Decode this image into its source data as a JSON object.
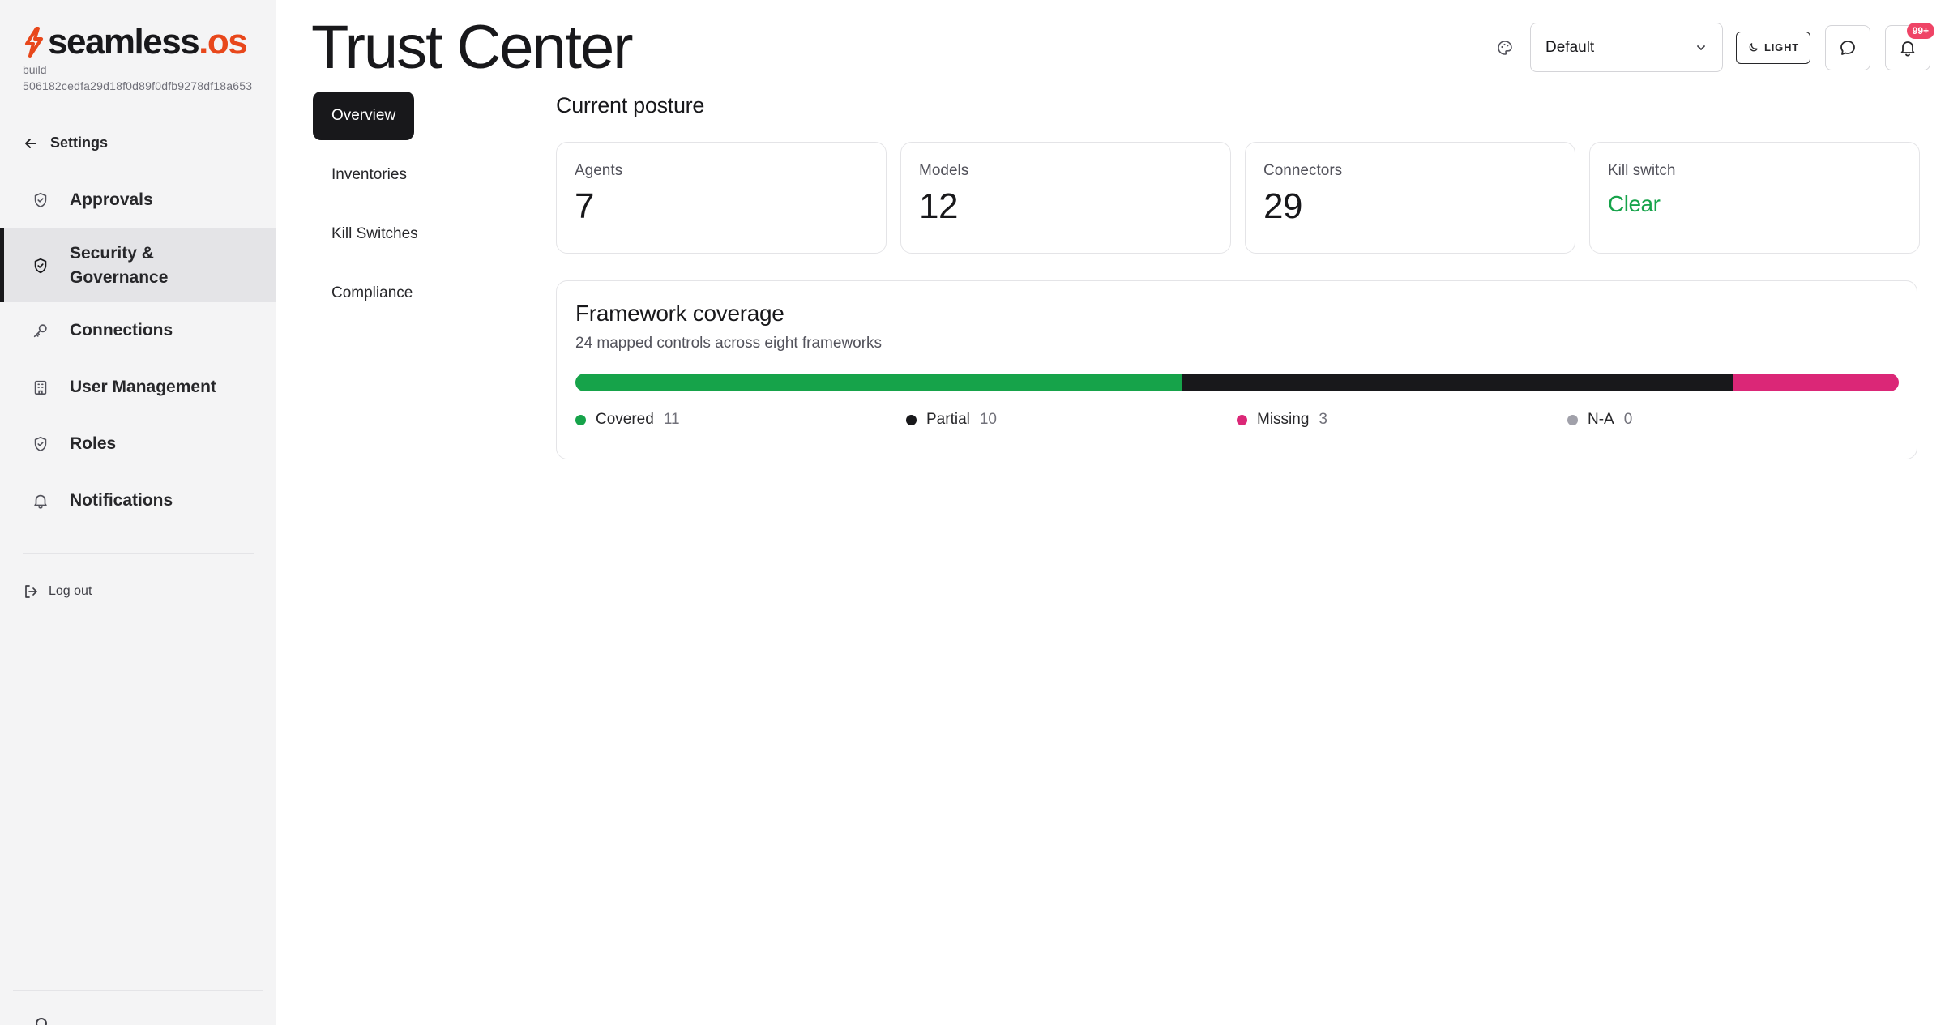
{
  "brand": {
    "logo_main": "seamless",
    "logo_suffix": ".os",
    "build_label": "build",
    "build_hash": "506182cedfa29d18f0d89f0dfb9278df18a653"
  },
  "sidebar": {
    "back_label": "Settings",
    "items": [
      {
        "label": "Approvals",
        "icon": "shield-check-icon",
        "active": false
      },
      {
        "label": "Security & Governance",
        "icon": "shield-check-icon",
        "active": true
      },
      {
        "label": "Connections",
        "icon": "key-icon",
        "active": false
      },
      {
        "label": "User Management",
        "icon": "building-icon",
        "active": false
      },
      {
        "label": "Roles",
        "icon": "shield-check-icon",
        "active": false
      },
      {
        "label": "Notifications",
        "icon": "bell-icon",
        "active": false
      }
    ],
    "logout_label": "Log out"
  },
  "header": {
    "title": "Trust Center",
    "theme_select_value": "Default",
    "mode_button_label": "LIGHT",
    "notification_badge": "99+"
  },
  "subtabs": [
    {
      "label": "Overview",
      "active": true
    },
    {
      "label": "Inventories",
      "active": false
    },
    {
      "label": "Kill Switches",
      "active": false
    },
    {
      "label": "Compliance",
      "active": false
    }
  ],
  "posture": {
    "title": "Current posture",
    "stats": [
      {
        "label": "Agents",
        "value": "7"
      },
      {
        "label": "Models",
        "value": "12"
      },
      {
        "label": "Connectors",
        "value": "29"
      },
      {
        "label": "Kill switch",
        "value": "Clear"
      }
    ]
  },
  "coverage": {
    "title": "Framework coverage",
    "subtitle": "24 mapped controls across eight frameworks",
    "segments": [
      {
        "label": "Covered",
        "count": 11,
        "color": "#16a34a"
      },
      {
        "label": "Partial",
        "count": 10,
        "color": "#18181b"
      },
      {
        "label": "Missing",
        "count": 3,
        "color": "#db2777"
      },
      {
        "label": "N-A",
        "count": 0,
        "color": "#a1a1aa"
      }
    ]
  },
  "colors": {
    "accent": "#e8471b",
    "ok": "#16a34a",
    "badge": "#ef4466"
  }
}
